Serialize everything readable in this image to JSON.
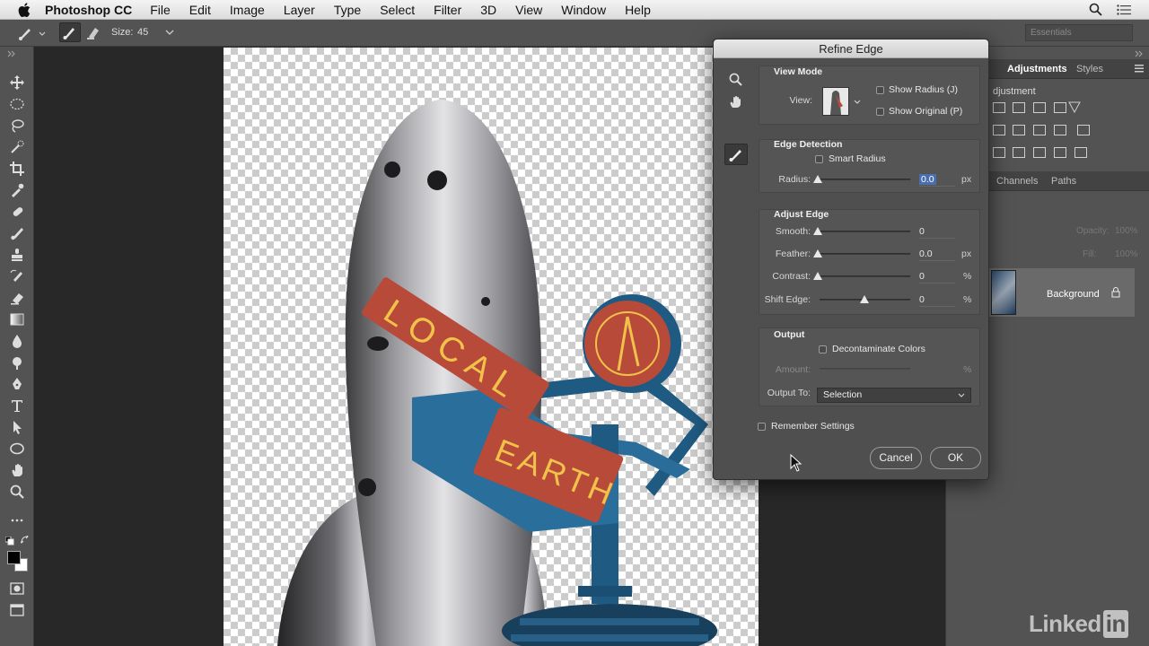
{
  "menubar": {
    "app_name": "Photoshop CC",
    "items": [
      "File",
      "Edit",
      "Image",
      "Layer",
      "Type",
      "Select",
      "Filter",
      "3D",
      "View",
      "Window",
      "Help"
    ]
  },
  "options_bar": {
    "size_label": "Size:",
    "size_value": "45",
    "workspace": "Essentials"
  },
  "dialog": {
    "title": "Refine Edge",
    "view_mode": {
      "heading": "View Mode",
      "view_label": "View:",
      "show_radius": "Show Radius (J)",
      "show_original": "Show Original (P)"
    },
    "edge_detection": {
      "heading": "Edge Detection",
      "smart_radius": "Smart Radius",
      "radius_label": "Radius:",
      "radius_value": "0.0",
      "radius_unit": "px"
    },
    "adjust_edge": {
      "heading": "Adjust Edge",
      "smooth_label": "Smooth:",
      "smooth_value": "0",
      "feather_label": "Feather:",
      "feather_value": "0.0",
      "feather_unit": "px",
      "contrast_label": "Contrast:",
      "contrast_value": "0",
      "contrast_unit": "%",
      "shift_label": "Shift Edge:",
      "shift_value": "0",
      "shift_unit": "%"
    },
    "output": {
      "heading": "Output",
      "decontaminate": "Decontaminate Colors",
      "amount_label": "Amount:",
      "amount_unit": "%",
      "output_to_label": "Output To:",
      "output_to_value": "Selection"
    },
    "remember": "Remember Settings",
    "cancel": "Cancel",
    "ok": "OK"
  },
  "right_panel": {
    "tabs_top": [
      "Adjustments",
      "Styles"
    ],
    "adjust_caption": "djustment",
    "tabs_layers": [
      "Channels",
      "Paths"
    ],
    "opacity_label": "Opacity:",
    "opacity_value": "100%",
    "fill_label": "Fill:",
    "fill_value": "100%",
    "layer_name": "Background"
  },
  "watermark": {
    "text": "Linked",
    "in": "in"
  },
  "colors": {
    "rocket_red": "#b84a3a",
    "rocket_blue": "#1f5a82",
    "sign_text": "#f0c24a"
  }
}
